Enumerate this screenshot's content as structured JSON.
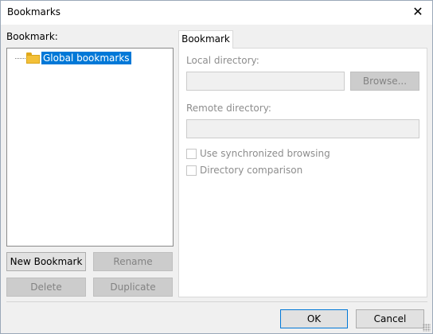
{
  "window": {
    "title": "Bookmarks",
    "close_icon": "close-icon"
  },
  "left": {
    "label": "Bookmark:",
    "tree": {
      "items": [
        {
          "label": "Global bookmarks",
          "icon": "folder-icon",
          "selected": true
        }
      ]
    },
    "buttons": {
      "new": "New Bookmark",
      "rename": "Rename",
      "delete": "Delete",
      "duplicate": "Duplicate"
    }
  },
  "right": {
    "tab": "Bookmark",
    "local_dir": {
      "label": "Local directory:",
      "value": "",
      "browse": "Browse..."
    },
    "remote_dir": {
      "label": "Remote directory:",
      "value": ""
    },
    "sync_browsing": {
      "label": "Use synchronized browsing",
      "checked": false
    },
    "dir_comparison": {
      "label": "Directory comparison",
      "checked": false
    }
  },
  "footer": {
    "ok": "OK",
    "cancel": "Cancel"
  },
  "colors": {
    "selection": "#0078d7",
    "folder": "#f3c038",
    "window_bg": "#f0f0f0"
  }
}
